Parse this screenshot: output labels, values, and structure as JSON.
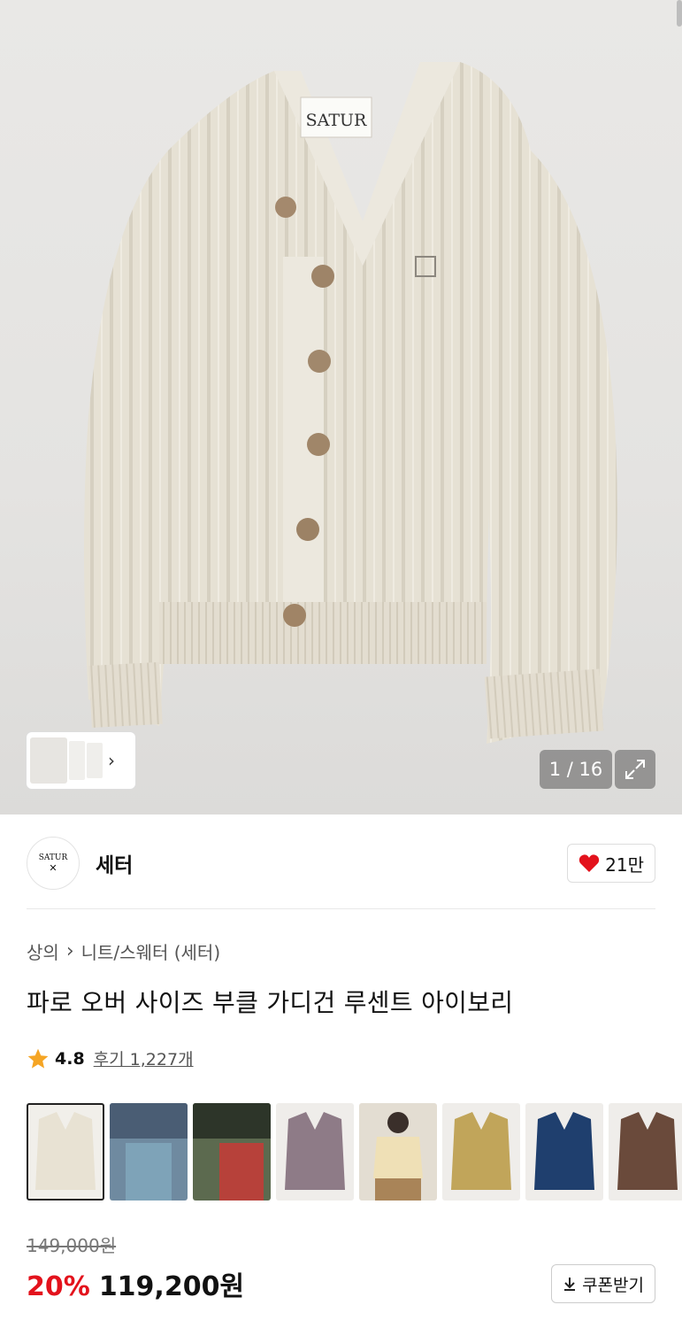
{
  "gallery": {
    "label_tag": "SATUR",
    "counter": "1 / 16",
    "icons": {
      "next": "chevron-right-icon",
      "expand": "expand-icon"
    }
  },
  "brand": {
    "logo_text": "SATUR",
    "name": "세터",
    "likes": "21만",
    "heart_color": "#e3121c"
  },
  "breadcrumb": {
    "category": "상의",
    "subcategory": "니트/스웨터 (세터)"
  },
  "product": {
    "title": "파로 오버 사이즈 부클 가디건 루센트 아이보리",
    "rating": "4.8",
    "reviews": "후기 1,227개"
  },
  "swatches": [
    {
      "name": "ivory",
      "color": "#e8e2d3"
    },
    {
      "name": "blue-lifestyle",
      "color": "#7ea3b8"
    },
    {
      "name": "red-lifestyle",
      "color": "#b7413a"
    },
    {
      "name": "mauve",
      "color": "#8e7b87"
    },
    {
      "name": "butter",
      "color": "#efe0b6"
    },
    {
      "name": "mustard",
      "color": "#c1a55a"
    },
    {
      "name": "navy",
      "color": "#1f3f6e"
    },
    {
      "name": "brown",
      "color": "#6a4a3b"
    }
  ],
  "pricing": {
    "original": "149,000원",
    "discount": "20%",
    "price": "119,200원",
    "coupon_label": "쿠폰받기"
  }
}
